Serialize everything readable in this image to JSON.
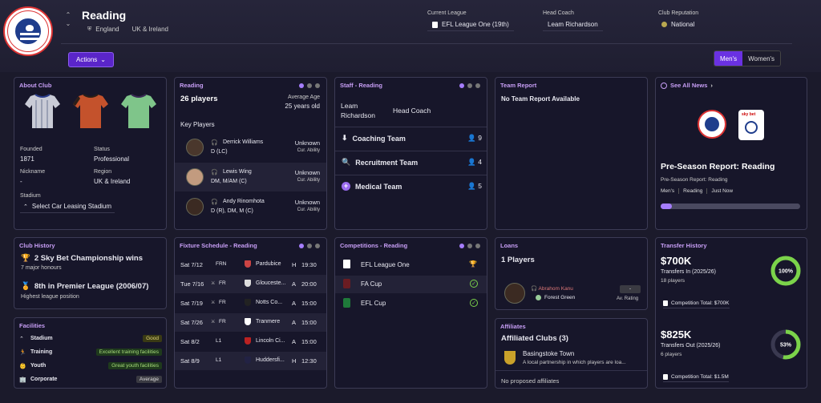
{
  "header": {
    "club_name": "Reading",
    "nation": "England",
    "region": "UK & Ireland",
    "current_league_label": "Current League",
    "current_league_value": "EFL League One (19th)",
    "head_coach_label": "Head Coach",
    "head_coach_value": "Leam Richardson",
    "reputation_label": "Club Reputation",
    "reputation_value": "National",
    "actions_label": "Actions",
    "tabs": [
      "Men's",
      "Women's"
    ]
  },
  "about": {
    "title": "About Club",
    "founded_label": "Founded",
    "founded_value": "1871",
    "status_label": "Status",
    "status_value": "Professional",
    "nickname_label": "Nickname",
    "nickname_value": "-",
    "region_label": "Region",
    "region_value": "UK & Ireland",
    "stadium_label": "Stadium",
    "stadium_value": "Select Car Leasing Stadium"
  },
  "squad": {
    "title": "Reading",
    "count": "26 players",
    "avg_age_label": "Average Age",
    "avg_age_value": "25 years old",
    "key_players_label": "Key Players",
    "players": [
      {
        "name": "Derrick Williams",
        "pos": "D (LC)",
        "ability": "Unknown",
        "ability_label": "Cur. Ability"
      },
      {
        "name": "Lewis Wing",
        "pos": "DM, M/AM (C)",
        "ability": "Unknown",
        "ability_label": "Cur. Ability"
      },
      {
        "name": "Andy Rinomhota",
        "pos": "D (R), DM, M (C)",
        "ability": "Unknown",
        "ability_label": "Cur. Ability"
      }
    ]
  },
  "staff": {
    "title": "Staff - Reading",
    "coach_name": "Leam Richardson",
    "coach_role": "Head Coach",
    "teams": [
      {
        "label": "Coaching Team",
        "count": "9"
      },
      {
        "label": "Recruitment Team",
        "count": "4"
      },
      {
        "label": "Medical Team",
        "count": "5"
      }
    ]
  },
  "team_report": {
    "title": "Team Report",
    "text": "No Team Report Available"
  },
  "news": {
    "title": "See All News",
    "headline": "Pre-Season Report: Reading",
    "sub": "Pre-Season Report: Reading",
    "tags": [
      "Men's",
      "Reading",
      "Just Now"
    ],
    "progress": 0.08
  },
  "history": {
    "title": "Club History",
    "item1_title": "2 Sky Bet Championship wins",
    "item1_sub": "7 major honours",
    "item2_title": "8th in Premier League (2006/07)",
    "item2_sub": "Highest league position"
  },
  "fixtures": {
    "title": "Fixture Schedule - Reading",
    "rows": [
      {
        "date": "Sat 7/12",
        "comp": "FRN",
        "opp": "Pardubice",
        "venue": "H",
        "time": "19:30"
      },
      {
        "date": "Tue 7/16",
        "comp": "FR",
        "opp": "Glouceste...",
        "venue": "A",
        "time": "20:00"
      },
      {
        "date": "Sat 7/19",
        "comp": "FR",
        "opp": "Notts Co...",
        "venue": "A",
        "time": "15:00"
      },
      {
        "date": "Sat 7/26",
        "comp": "FR",
        "opp": "Tranmere",
        "venue": "A",
        "time": "15:00"
      },
      {
        "date": "Sat 8/2",
        "comp": "L1",
        "opp": "Lincoln Ci...",
        "venue": "A",
        "time": "15:00"
      },
      {
        "date": "Sat 8/9",
        "comp": "L1",
        "opp": "Huddersfi...",
        "venue": "H",
        "time": "12:30"
      }
    ]
  },
  "competitions": {
    "title": "Competitions - Reading",
    "items": [
      "EFL League One",
      "FA Cup",
      "EFL Cup"
    ]
  },
  "loans": {
    "title": "Loans",
    "count": "1 Players",
    "player": "Abrahom Kanu",
    "club": "Forest Green",
    "rating_badge": "-",
    "rating_label": "Av. Rating"
  },
  "affiliates": {
    "title": "Affiliates",
    "heading": "Affiliated Clubs (3)",
    "club": "Basingstoke Town",
    "desc": "A local partnership in which players are loa...",
    "proposed": "No proposed affiliates"
  },
  "transfers": {
    "title": "Transfer History",
    "in_amount": "$700K",
    "in_label": "Transfers In (2025/26)",
    "in_players": "18 players",
    "in_percent": "100%",
    "in_fraction": 1.0,
    "in_total": "Competition Total: $700K",
    "out_amount": "$825K",
    "out_label": "Transfers Out (2025/26)",
    "out_players": "6 players",
    "out_percent": "53%",
    "out_fraction": 0.53,
    "out_total": "Competition Total: $1.5M"
  },
  "facilities": {
    "title": "Facilities",
    "rows": [
      {
        "label": "Stadium",
        "value": "Good"
      },
      {
        "label": "Training",
        "value": "Excellent training facilities"
      },
      {
        "label": "Youth",
        "value": "Great youth facilities"
      },
      {
        "label": "Corporate",
        "value": "Average"
      }
    ]
  },
  "colors": {
    "accent": "#6a31e2",
    "title": "#c79ef5",
    "green": "#7bd34a"
  }
}
